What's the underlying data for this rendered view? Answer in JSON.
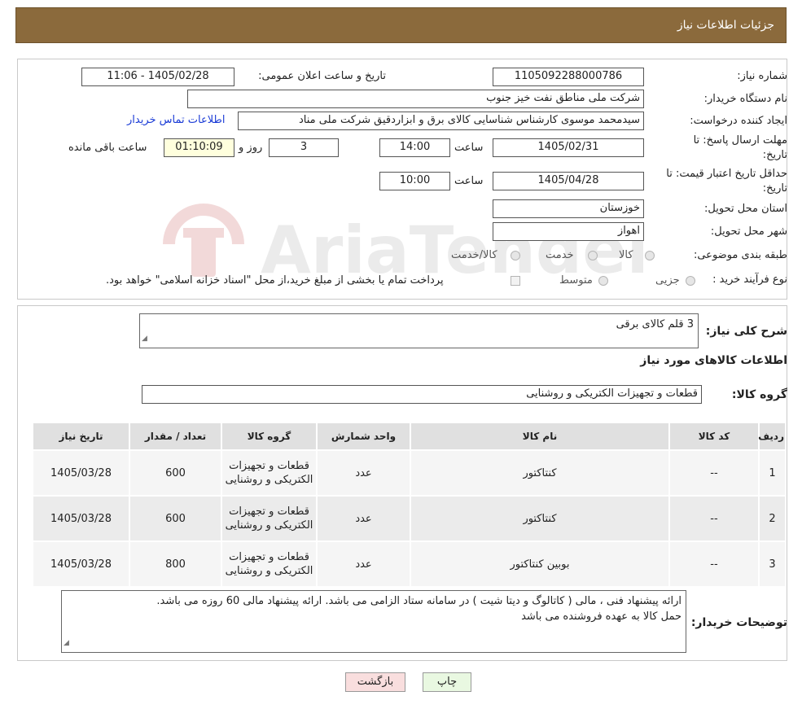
{
  "page_title": "جزئیات اطلاعات نیاز",
  "fields": {
    "need_number_label": "شماره نیاز:",
    "need_number": "1105092288000786",
    "announce_datetime_label": "تاریخ و ساعت اعلان عمومی:",
    "announce_datetime": "1405/02/28 - 11:06",
    "buyer_org_label": "نام دستگاه خریدار:",
    "buyer_org": "شرکت ملی مناطق نفت خیز جنوب",
    "requester_label": "ایجاد کننده درخواست:",
    "requester": "سیدمحمد موسوی کارشناس شناسایی کالای برق و ابزاردقیق شرکت ملی مناد",
    "contact_link": "اطلاعات تماس خریدار",
    "reply_deadline_label_1": "مهلت ارسال پاسخ: تا",
    "reply_deadline_label_2": "تاریخ:",
    "reply_date": "1405/02/31",
    "time_label": "ساعت",
    "reply_time": "14:00",
    "days_count": "3",
    "days_label": "روز و",
    "remaining_time": "01:10:09",
    "remaining_label": "ساعت باقی مانده",
    "price_validity_label_1": "حداقل تاریخ اعتبار قیمت: تا",
    "price_validity_label_2": "تاریخ:",
    "price_validity_date": "1405/04/28",
    "price_validity_time": "10:00",
    "province_label": "استان محل تحویل:",
    "province": "خوزستان",
    "city_label": "شهر محل تحویل:",
    "city": "اهواز",
    "category_label": "طبقه بندی موضوعی:",
    "category_options": [
      "کالا",
      "خدمت",
      "کالا/خدمت"
    ],
    "process_label": "نوع فرآیند خرید :",
    "process_options": [
      "جزیی",
      "متوسط"
    ],
    "payment_note": "پرداخت تمام یا بخشی از مبلغ خرید،از محل \"اسناد خزانه اسلامی\" خواهد بود."
  },
  "summary": {
    "label": "شرح کلی نیاز:",
    "value": "3 قلم کالای برقی"
  },
  "goods_info_title": "اطلاعات کالاهای مورد نیاز",
  "goods_group": {
    "label": "گروه کالا:",
    "value": "قطعات و تجهیزات الکتریکی و روشنایی"
  },
  "table": {
    "headers": [
      "ردیف",
      "کد کالا",
      "نام کالا",
      "واحد شمارش",
      "گروه کالا",
      "تعداد / مقدار",
      "تاریخ نیاز"
    ],
    "rows": [
      [
        "1",
        "--",
        "کنتاکتور",
        "عدد",
        "قطعات و تجهیزات الکتریکی و روشنایی",
        "600",
        "1405/03/28"
      ],
      [
        "2",
        "--",
        "کنتاکتور",
        "عدد",
        "قطعات و تجهیزات الکتریکی و روشنایی",
        "600",
        "1405/03/28"
      ],
      [
        "3",
        "--",
        "بوبین کنتاکتور",
        "عدد",
        "قطعات و تجهیزات الکتریکی و روشنایی",
        "800",
        "1405/03/28"
      ]
    ]
  },
  "buyer_notes": {
    "label": "توضیحات خریدار:",
    "line1": "ارائه پیشنهاد فنی ، مالی ( کاتالوگ و دیتا شیت ) در سامانه ستاد الزامی می باشد. ارائه پیشنهاد مالی 60 روزه می باشد.",
    "line2": "حمل کالا به عهده فروشنده می باشد"
  },
  "buttons": {
    "print": "چاپ",
    "back": "بازگشت"
  },
  "watermark_text": "AriaTender.neT",
  "colors": {
    "header_bg": "#8b6a3c",
    "link": "#1a3bd6",
    "back_button_bg": "#f9dede",
    "print_button_bg": "#e9f8e1"
  }
}
